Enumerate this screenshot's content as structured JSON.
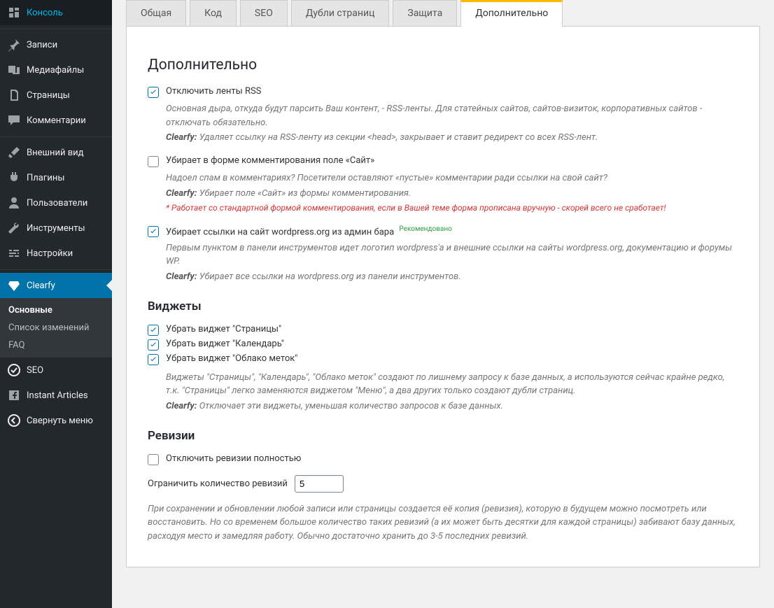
{
  "sidebar": {
    "items": [
      {
        "label": "Консоль",
        "icon": "dashboard"
      },
      {
        "label": "Записи",
        "icon": "pin"
      },
      {
        "label": "Медиафайлы",
        "icon": "media"
      },
      {
        "label": "Страницы",
        "icon": "pages"
      },
      {
        "label": "Комментарии",
        "icon": "comments"
      },
      {
        "label": "Внешний вид",
        "icon": "brush"
      },
      {
        "label": "Плагины",
        "icon": "plug"
      },
      {
        "label": "Пользователи",
        "icon": "user"
      },
      {
        "label": "Инструменты",
        "icon": "wrench"
      },
      {
        "label": "Настройки",
        "icon": "sliders"
      },
      {
        "label": "Clearfy",
        "icon": "diamond"
      },
      {
        "label": "SEO",
        "icon": "seo"
      },
      {
        "label": "Instant Articles",
        "icon": "facebook"
      },
      {
        "label": "Свернуть меню",
        "icon": "collapse"
      }
    ],
    "sub": [
      {
        "label": "Основные"
      },
      {
        "label": "Список изменений"
      },
      {
        "label": "FAQ"
      }
    ]
  },
  "tabs": [
    "Общая",
    "Код",
    "SEO",
    "Дубли страниц",
    "Защита",
    "Дополнительно"
  ],
  "active_tab": "Дополнительно",
  "content": {
    "h2": "Дополнительно",
    "opt_rss": {
      "label": "Отключить ленты RSS",
      "desc": "Основная дыра, откуда будут парсить Ваш контент, - RSS-ленты. Для статейных сайтов, сайтов-визиток, корпоративных сайтов - отключать обязательно.",
      "clearfy": "Удаляет ссылку на RSS-ленту из секции <head>, закрывает и ставит редирект со всех RSS-лент."
    },
    "opt_site_field": {
      "label": "Убирает в форме комментирования поле «Сайт»",
      "desc": "Надоел спам в комментариях? Посетители оставляют «пустые» комментарии ради ссылки на свой сайт?",
      "clearfy": "Убирает поле «Сайт» из формы комментирования.",
      "warn": "* Работает со стандартной формой комментирования, если в Вашей теме форма прописана вручную - скорей всего не сработает!"
    },
    "opt_wp_links": {
      "label": "Убирает ссылки на сайт wordpress.org из админ бара",
      "reco": "Рекомендовано",
      "desc": "Первым пунктом в панели инструментов идет логотип wordpress'а и внешние ссылки на сайты wordpress.org, документацию и форумы WP.",
      "clearfy": "Убирает все ссылки на wordpress.org из панели инструментов."
    },
    "widgets_h": "Виджеты",
    "w_pages": "Убрать виджет \"Страницы\"",
    "w_cal": "Убрать виджет \"Календарь\"",
    "w_tags": "Убрать виджет \"Облако меток\"",
    "widgets_desc": "Виджеты \"Страницы\", \"Календарь\", \"Облако меток\" создают по лишнему запросу к базе данных, а используются сейчас крайне редко, т.к. \"Страницы\" легко заменяются виджетом \"Меню\", а два других только создают дубли страниц.",
    "widgets_clearfy": "Отключает эти виджеты, уменьшая количество запросов к базе данных.",
    "revisions_h": "Ревизии",
    "rev_disable": "Отключить ревизии полностью",
    "rev_limit_label": "Ограничить количество ревизий",
    "rev_limit_value": "5",
    "rev_desc": "При сохранении и обновлении любой записи или страницы создается её копия (ревизия), которую в будущем можно посмотреть или восстановить. Но со временем большое количество таких ревизий (а их может быть десятки для каждой страницы) забивают базу данных, расходуя место и замедляя работу. Обычно достаточно хранить до 3-5 последних ревизий.",
    "clearfy_prefix": "Clearfy:"
  }
}
